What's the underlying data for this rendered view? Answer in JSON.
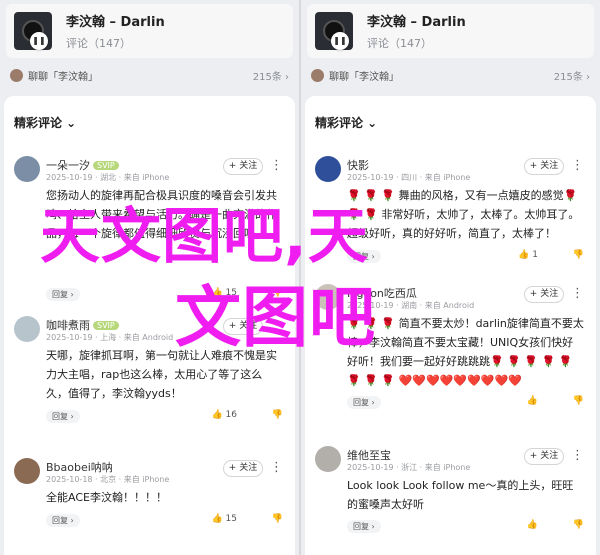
{
  "panels": [
    {
      "song": {
        "title": "李汶翰 – Darlin",
        "comments_label": "评论（147）",
        "pause_icon": "pause-icon"
      },
      "chat_bar": {
        "text": "聊聊「李汶翰」",
        "likes": "215条 ›"
      },
      "sheet_title": "精彩评论 ⌄",
      "comments": [
        {
          "user": "一朵一汐",
          "vip": "SVIP",
          "avatar_color": "#7b8ea5",
          "meta": "2025-10-19 · 湖北 · 来自 iPhone",
          "follow": "+ 关注",
          "more": "⋮",
          "text": "您扬动人的旋律再配合极具识度的嗓音会引发共鸣、给主人带来希望与活力。确是一曲充满的作品，每一个旋律都值得细细欣赏与沉浸回味。",
          "reply": "回复 ›",
          "likes": "👍 15",
          "dislikes": "👎"
        },
        {
          "user": "咖啡煮雨",
          "vip": "SVIP",
          "avatar_color": "#b8c4cc",
          "meta": "2025-10-19 · 上海 · 来自 Android",
          "follow": "+ 关注",
          "more": "⋮",
          "text": "天哪，旋律抓耳啊，第一句就让人难痕不愧是实力大主唱，rap也这么棒，太用心了等了这么久，值得了，李汶翰yyds！",
          "reply": "回复 ›",
          "likes": "👍 16",
          "dislikes": "👎"
        },
        {
          "user": "Bbaobei呐呐",
          "vip": "",
          "avatar_color": "#8a6a52",
          "meta": "2025-10-18 · 北京 · 来自 iPhone",
          "follow": "+ 关注",
          "more": "⋮",
          "text": "全能ACE李汶翰！！！！",
          "reply": "回复 ›",
          "likes": "👍 15",
          "dislikes": "👎"
        }
      ]
    },
    {
      "song": {
        "title": "李汶翰 – Darlin",
        "comments_label": "评论（147）",
        "pause_icon": "pause-icon"
      },
      "chat_bar": {
        "text": "聊聊「李汶翰」",
        "likes": "215条 ›"
      },
      "sheet_title": "精彩评论 ⌄",
      "comments": [
        {
          "user": "快影",
          "vip": "",
          "avatar_color": "#2f4f9a",
          "meta": "2025-10-19 · 四川 · 来自 iPhone",
          "follow": "+ 关注",
          "more": "⋮",
          "text": "🌹 🌹 🌹 舞曲的风格，又有一点嬉皮的感觉🌹 🌹 🌹 非常好听，太帅了，太棒了。太帅耳了。 超级好听，真的好好听，简直了，太棒了！",
          "reply": "回复 ›",
          "likes": "👍 1",
          "dislikes": "👎"
        },
        {
          "user": "Pigeon吃西瓜",
          "vip": "",
          "avatar_color": "#c9c2b6",
          "meta": "2025-10-19 · 湖南 · 来自 Android",
          "follow": "+ 关注",
          "more": "⋮",
          "text": "🌹 🌹 🌹 简直不要太炒！darlin旋律简直不要太棒，李汶翰简直不要太宝藏！UNIQ女孩们快好好听！我们要一起好好跳跳跳🌹 🌹 🌹 🌹 🌹 🌹 🌹 🌹 ❤️❤️❤️❤️❤️❤️❤️❤️❤️",
          "reply": "回复 ›",
          "likes": "👍",
          "dislikes": "👎"
        },
        {
          "user": "维他至宝",
          "vip": "",
          "avatar_color": "#b2afab",
          "meta": "2025-10-19 · 浙江 · 来自 iPhone",
          "follow": "+ 关注",
          "more": "⋮",
          "text": "Look look Look follow me～真的上头，旺旺的蜜嗓声太好听",
          "reply": "回复 ›",
          "likes": "👍",
          "dislikes": "👎"
        }
      ]
    }
  ],
  "watermark": {
    "line1": "天文图吧,天",
    "line2": "文图吧",
    "color": "#f01df0"
  }
}
